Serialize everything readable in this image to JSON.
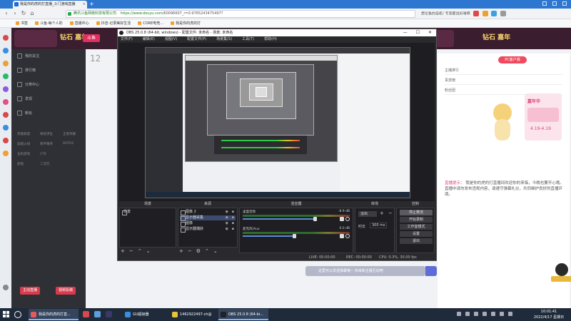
{
  "browser": {
    "tab_title": "我是你的虎的打直播_斗门游戏直播",
    "new_tab": "+",
    "url_host": "https://www.douyu.com",
    "url_path": "/60096607_r=0.9765243475497?",
    "company": "腾讯斗鱼网络科技有限公司",
    "bookmarks": [
      "书签",
      "斗鱼·每个人的",
      "直播中心",
      "抖音·记录美好生活",
      "CORE电竞...",
      "我是你的虎的打"
    ],
    "right_text": "费伦鱼的挂机! 专家都说好难啊"
  },
  "page": {
    "banner_logo": "钻石 嘉年",
    "banner_tag": "斗鱼",
    "banner_logo_right": "钻石 嘉年",
    "sidebar_items": [
      "我的关注",
      "排行榜",
      "分类中心",
      "发现",
      "新玩"
    ],
    "sidebar_links": [
      "英雄联盟",
      "绝地求生",
      "王者荣耀",
      "穿越火线",
      "和平精英",
      "DOTA2",
      "主机游戏",
      "户外",
      "颜值",
      "二次元"
    ],
    "sidebar_btns": [
      "主动直播",
      "视频投稿"
    ],
    "mid_ghost": "12",
    "right_btn": "PC客户端",
    "right_rows": [
      "主播排行",
      "贵宾榜",
      "粉丝团"
    ],
    "promo_title": "嘉年华",
    "promo_dates": "4.19-4.19",
    "notice_label": "直播提示：",
    "notice_text": "我是你的虎的打直播间欢迎你的来临，今晚也要开心哦。直播中请勿发布违规内容，请遵守弹幕礼仪，共同维护良好的直播环境。",
    "chat_placeholder": "这里可以发送弹幕哦~ 快来和主播互动吧"
  },
  "obs": {
    "title": "OBS 25.0.8 (64-bit, windows) - 配置文件: 未命名 - 场景: 未命名",
    "menu": [
      "文件(F)",
      "编辑(E)",
      "视图(V)",
      "配置文件(P)",
      "场景集(S)",
      "工具(T)",
      "帮助(H)"
    ],
    "docks": {
      "scenes_title": "场景",
      "sources_title": "来源",
      "mixer_title": "混音器",
      "transitions_title": "转场",
      "controls_title": "控制"
    },
    "scenes": [
      "场景"
    ],
    "sources": [
      {
        "name": "图像 2",
        "selected": false
      },
      {
        "name": "显示器采集",
        "selected": true
      },
      {
        "name": "图像",
        "selected": false
      },
      {
        "name": "显示器捕获",
        "selected": false
      }
    ],
    "mixer": [
      {
        "name": "桌面音频",
        "db": "-8.9 dB",
        "level": 0.78
      },
      {
        "name": "麦克风/Aux",
        "db": "0.0 dB",
        "level": 0.55
      }
    ],
    "transition": {
      "type": "淡出",
      "duration_label": "时长",
      "duration": "300 ms"
    },
    "controls": [
      "停止推流",
      "开始录制",
      "工作室模式",
      "设置",
      "退出"
    ],
    "status": {
      "live": "LIVE: 00:00:00",
      "rec": "REC: 00:00:00",
      "cpu": "CPU: 0.3%, 30.00 fps",
      "drop": "kb/s: 0"
    },
    "window_controls": [
      "—",
      "☐",
      "✕"
    ]
  },
  "taskbar": {
    "apps": [
      {
        "label": "我是你的虎的打直...",
        "color": "#e85a5a",
        "active": true
      },
      {
        "label": "GU超级器",
        "color": "#3b8de0",
        "active": false
      },
      {
        "label": "1462922497-ch@",
        "color": "#e8c23b",
        "active": false
      },
      {
        "label": "OBS 25.0.8 (64-bi...",
        "color": "#222",
        "active": true
      }
    ],
    "time": "10:01:41",
    "date": "2022/4/17 星期日"
  },
  "colors": {
    "tabbar": "#2d77d1",
    "obs_bg": "#2a2a2e",
    "taskbar": "#1f2a3a",
    "banner": "#3a1d2e"
  }
}
